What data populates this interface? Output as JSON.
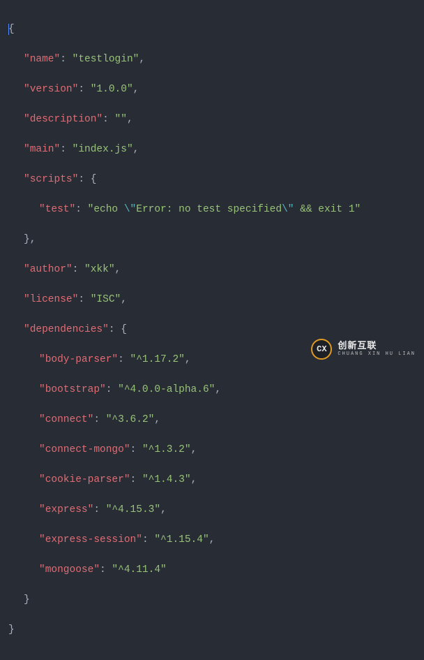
{
  "pkg": {
    "name_key": "\"name\"",
    "name_val": "\"testlogin\"",
    "version_key": "\"version\"",
    "version_val": "\"1.0.0\"",
    "description_key": "\"description\"",
    "description_val": "\"\"",
    "main_key": "\"main\"",
    "main_val": "\"index.js\"",
    "scripts_key": "\"scripts\"",
    "test_key": "\"test\"",
    "test_val_a": "\"echo ",
    "test_esc1": "\\\"",
    "test_val_b": "Error: no test specified",
    "test_esc2": "\\\"",
    "test_val_c": " && exit 1\"",
    "author_key": "\"author\"",
    "author_val": "\"xkk\"",
    "license_key": "\"license\"",
    "license_val": "\"ISC\"",
    "deps_key": "\"dependencies\"",
    "deps": {
      "body_parser_key": "\"body-parser\"",
      "body_parser_val": "\"^1.17.2\"",
      "bootstrap_key": "\"bootstrap\"",
      "bootstrap_val": "\"^4.0.0-alpha.6\"",
      "connect_key": "\"connect\"",
      "connect_val": "\"^3.6.2\"",
      "connect_mongo_key": "\"connect-mongo\"",
      "connect_mongo_val": "\"^1.3.2\"",
      "cookie_parser_key": "\"cookie-parser\"",
      "cookie_parser_val": "\"^1.4.3\"",
      "express_key": "\"express\"",
      "express_val": "\"^4.15.3\"",
      "express_session_key": "\"express-session\"",
      "express_session_val": "\"^1.15.4\"",
      "mongoose_key": "\"mongoose\"",
      "mongoose_val": "\"^4.11.4\""
    }
  },
  "sym": {
    "colon_sp": ": ",
    "comma": ",",
    "open_brace": "{",
    "close_brace": "}",
    "close_brace_comma": "},"
  },
  "watermark": {
    "icon_text": "CX",
    "title": "创新互联",
    "sub": "CHUANG XIN HU LIAN"
  }
}
